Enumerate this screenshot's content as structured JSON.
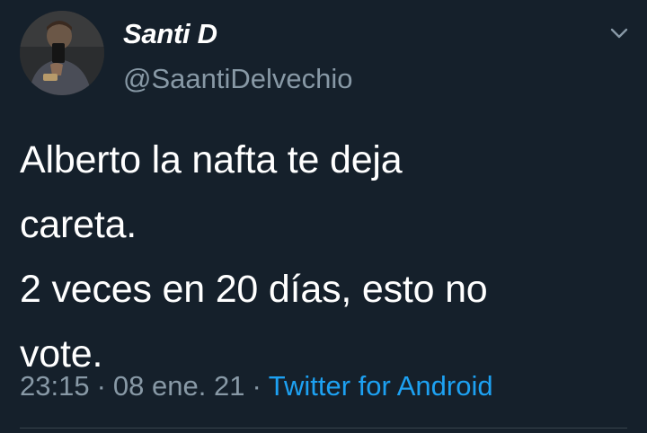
{
  "author": {
    "display_name": "Santi D",
    "username": "@SaantiDelvechio"
  },
  "tweet": {
    "text": "Alberto la nafta te deja\ncareta.\n2 veces en 20 días, esto no\nvote.",
    "time": "23:15",
    "date": "08 ene. 21",
    "separator": "·",
    "source": "Twitter for Android"
  },
  "icons": {
    "more": "chevron-down-icon",
    "avatar": "avatar"
  },
  "colors": {
    "background": "#15202b",
    "text": "#ffffff",
    "secondary_text": "#8899a6",
    "link": "#1da1f2",
    "divider": "#38444d"
  }
}
